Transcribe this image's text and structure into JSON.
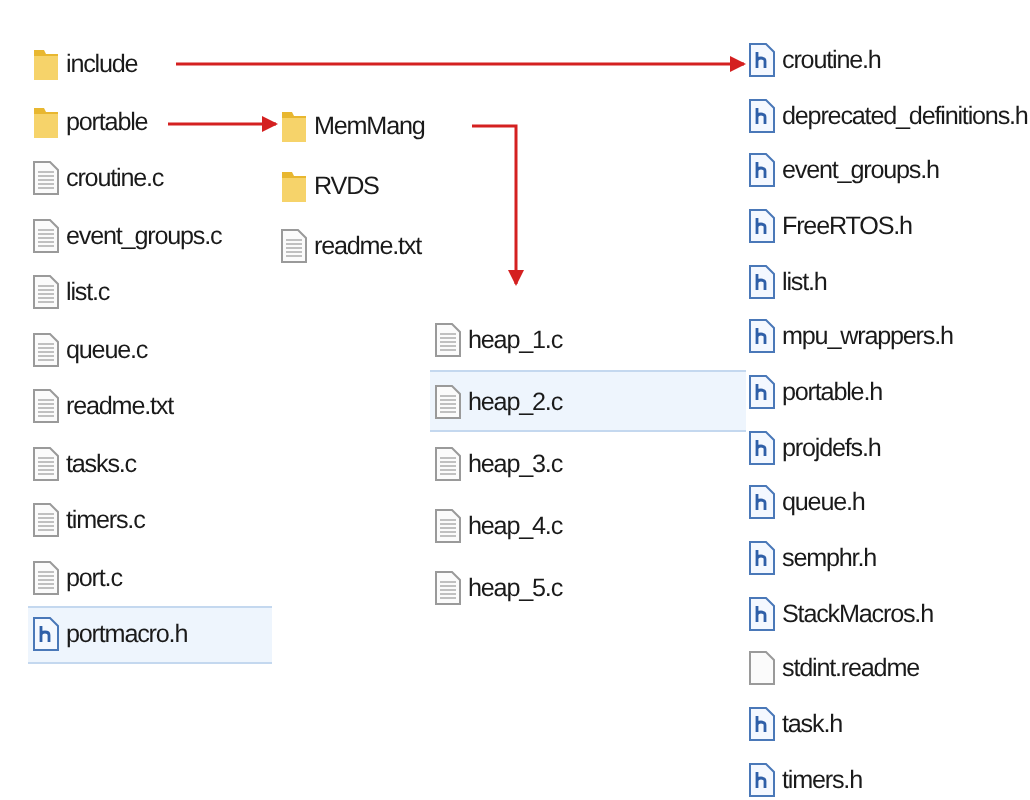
{
  "panels": [
    {
      "items": [
        {
          "name": "include",
          "kind": "folder",
          "selected": false
        },
        {
          "name": "portable",
          "kind": "folder",
          "selected": false
        },
        {
          "name": "croutine.c",
          "kind": "file",
          "selected": false
        },
        {
          "name": "event_groups.c",
          "kind": "file",
          "selected": false
        },
        {
          "name": "list.c",
          "kind": "file",
          "selected": false
        },
        {
          "name": "queue.c",
          "kind": "file",
          "selected": false
        },
        {
          "name": "readme.txt",
          "kind": "file",
          "selected": false
        },
        {
          "name": "tasks.c",
          "kind": "file",
          "selected": false
        },
        {
          "name": "timers.c",
          "kind": "file",
          "selected": false
        },
        {
          "name": "port.c",
          "kind": "file",
          "selected": false
        },
        {
          "name": "portmacro.h",
          "kind": "header",
          "selected": true
        }
      ]
    },
    {
      "items": [
        {
          "name": "MemMang",
          "kind": "folder",
          "selected": false
        },
        {
          "name": "RVDS",
          "kind": "folder",
          "selected": false
        },
        {
          "name": "readme.txt",
          "kind": "file",
          "selected": false
        }
      ]
    },
    {
      "items": [
        {
          "name": "heap_1.c",
          "kind": "file",
          "selected": false
        },
        {
          "name": "heap_2.c",
          "kind": "file",
          "selected": true
        },
        {
          "name": "heap_3.c",
          "kind": "file",
          "selected": false
        },
        {
          "name": "heap_4.c",
          "kind": "file",
          "selected": false
        },
        {
          "name": "heap_5.c",
          "kind": "file",
          "selected": false
        }
      ]
    },
    {
      "items": [
        {
          "name": "croutine.h",
          "kind": "header",
          "selected": false
        },
        {
          "name": "deprecated_definitions.h",
          "kind": "header",
          "selected": false
        },
        {
          "name": "event_groups.h",
          "kind": "header",
          "selected": false
        },
        {
          "name": "FreeRTOS.h",
          "kind": "header",
          "selected": false
        },
        {
          "name": "list.h",
          "kind": "header",
          "selected": false
        },
        {
          "name": "mpu_wrappers.h",
          "kind": "header",
          "selected": false
        },
        {
          "name": "portable.h",
          "kind": "header",
          "selected": false
        },
        {
          "name": "projdefs.h",
          "kind": "header",
          "selected": false
        },
        {
          "name": "queue.h",
          "kind": "header",
          "selected": false
        },
        {
          "name": "semphr.h",
          "kind": "header",
          "selected": false
        },
        {
          "name": "StackMacros.h",
          "kind": "header",
          "selected": false
        },
        {
          "name": "stdint.readme",
          "kind": "plain",
          "selected": false
        },
        {
          "name": "task.h",
          "kind": "header",
          "selected": false
        },
        {
          "name": "timers.h",
          "kind": "header",
          "selected": false
        }
      ]
    }
  ]
}
